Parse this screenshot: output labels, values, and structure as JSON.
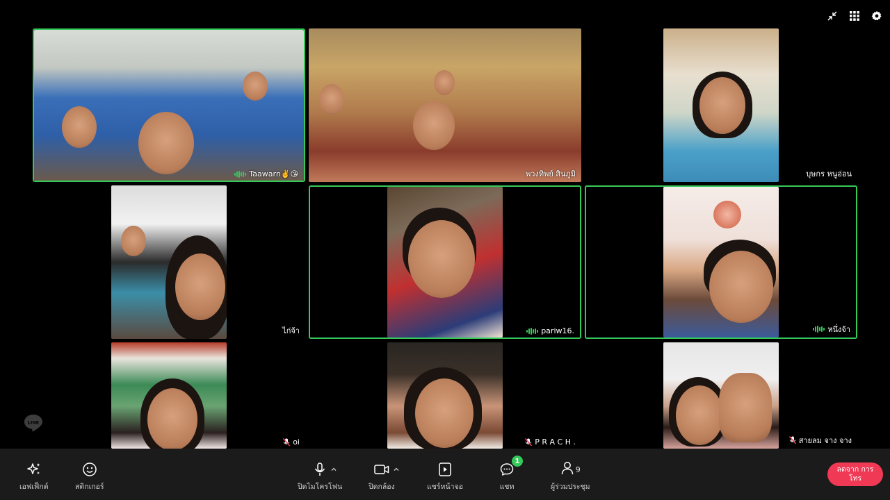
{
  "top_icons": [
    "collapse-icon",
    "grid-view-icon",
    "settings-icon"
  ],
  "participants": [
    {
      "name": "Taawarn✌️😘",
      "speaking": true,
      "muted": false
    },
    {
      "name": "พวงทิพย์  สินภูมิ",
      "speaking": false,
      "muted": false
    },
    {
      "name": "บุษกร หนูอ่อน",
      "speaking": false,
      "muted": false
    },
    {
      "name": "ไก่จ้า",
      "speaking": false,
      "muted": false
    },
    {
      "name": "pariw16.",
      "speaking": true,
      "muted": false
    },
    {
      "name": "หนึ่งจ้า",
      "speaking": true,
      "muted": false
    },
    {
      "name": "oi",
      "speaking": false,
      "muted": true
    },
    {
      "name": "P R A C H .",
      "speaking": false,
      "muted": true
    },
    {
      "name": "สายลม จาง จาง",
      "speaking": false,
      "muted": true
    }
  ],
  "toolbar": {
    "effects_label": "เอฟเฟ็กต์",
    "sticker_label": "สติกเกอร์",
    "mic_label": "ปิดไมโครโฟน",
    "camera_label": "ปิดกล้อง",
    "share_label": "แชร์หน้าจอ",
    "chat_label": "แชท",
    "chat_badge": "1",
    "participants_label": "ผู้ร่วมประชุม",
    "participants_count": "9",
    "leave_label": "ลดจาก การโทร"
  },
  "colors": {
    "speaking_border": "#35c95a",
    "toolbar_bg": "#1b1b1b",
    "leave_button": "#f03a55",
    "badge": "#35c95a"
  }
}
